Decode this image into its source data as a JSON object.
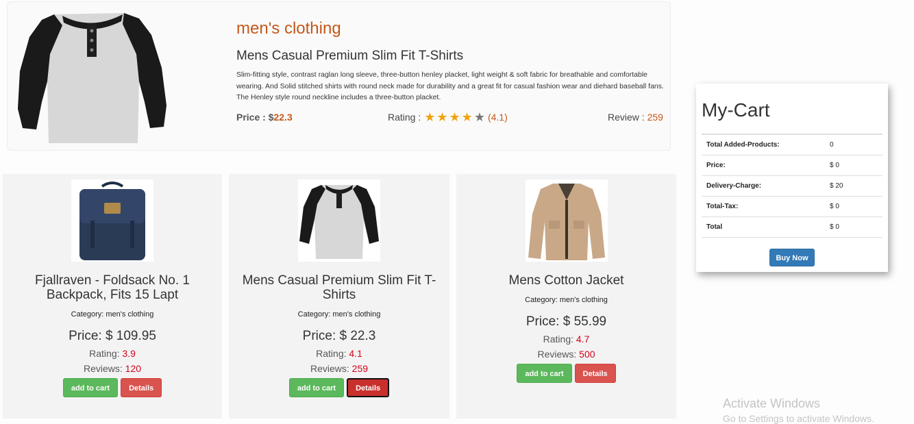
{
  "featured": {
    "category": "men's clothing",
    "title": "Mens Casual Premium Slim Fit T-Shirts",
    "description": "Slim-fitting style, contrast raglan long sleeve, three-button henley placket, light weight & soft fabric for breathable and comfortable wearing. And Solid stitched shirts with round neck made for durability and a great fit for casual fashion wear and diehard baseball fans. The Henley style round neckline includes a three-button placket.",
    "price_label": "Price : $",
    "price_value": "22.3",
    "rating_label": "Rating :",
    "rating_value": "(4.1)",
    "rating_stars": 4.1,
    "review_label": "Review :",
    "review_value": "259"
  },
  "products": [
    {
      "name": "Fjallraven - Foldsack No. 1 Backpack, Fits 15 Lapt",
      "category": "Category: men's clothing",
      "price": "Price: $ 109.95",
      "rating_label": "Rating: ",
      "rating": "3.9",
      "reviews_label": "Reviews: ",
      "reviews": "120",
      "add_label": "add to cart",
      "details_label": "Details"
    },
    {
      "name": "Mens Casual Premium Slim Fit T-Shirts",
      "category": "Category: men's clothing",
      "price": "Price: $ 22.3",
      "rating_label": "Rating: ",
      "rating": "4.1",
      "reviews_label": "Reviews: ",
      "reviews": "259",
      "add_label": "add to cart",
      "details_label": "Details"
    },
    {
      "name": "Mens Cotton Jacket",
      "category": "Category: men's clothing",
      "price": "Price: $ 55.99",
      "rating_label": "Rating: ",
      "rating": "4.7",
      "reviews_label": "Reviews: ",
      "reviews": "500",
      "add_label": "add to cart",
      "details_label": "Details"
    }
  ],
  "cart": {
    "title": "My-Cart",
    "rows": [
      {
        "label": "Total Added-Products:",
        "value": "0"
      },
      {
        "label": "Price:",
        "value": "$ 0"
      },
      {
        "label": "Delivery-Charge:",
        "value": "$ 20"
      },
      {
        "label": "Total-Tax:",
        "value": "$ 0"
      },
      {
        "label": "Total",
        "value": "$ 0"
      }
    ],
    "buy_label": "Buy Now"
  },
  "watermark": {
    "line1": "Activate Windows",
    "line2": "Go to Settings to activate Windows."
  },
  "colors": {
    "accent": "#c5581a",
    "star": "#f0a30a",
    "value_red": "#d0021b",
    "green": "#5cb85c",
    "red": "#d9534f",
    "blue": "#337ab7"
  }
}
